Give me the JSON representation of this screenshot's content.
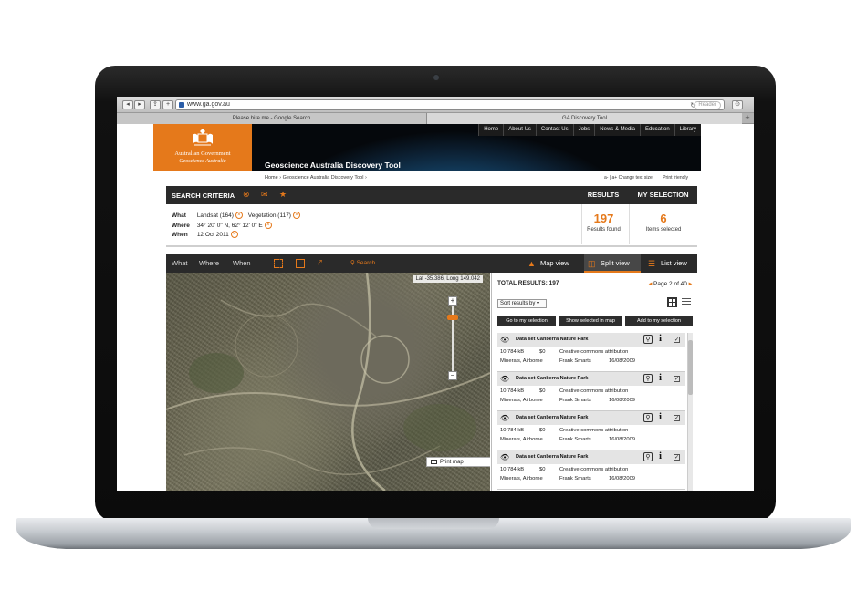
{
  "browser": {
    "url": "www.ga.gov.au",
    "reader_label": "Reader",
    "tabs": [
      "Please hire me - Google Search",
      "GA Discovery Tool"
    ]
  },
  "site": {
    "logo_line1": "Australian Government",
    "logo_line2": "Geoscience Australia",
    "topnav": [
      "Home",
      "About Us",
      "Contact Us",
      "Jobs",
      "News & Media",
      "Education",
      "Library"
    ],
    "tool_title": "Geoscience Australia Discovery Tool",
    "breadcrumb": [
      "Home",
      "Geoscience Australia Discovery Tool"
    ],
    "text_size_label": "a- | a+ Change text size",
    "print_friendly_label": "Print friendly"
  },
  "criteria": {
    "title": "SEARCH CRITERIA",
    "what_label": "What",
    "what_values": [
      "Landsat (164)",
      "Vegetation (117)"
    ],
    "where_label": "Where",
    "where_value": "34° 20' 0\" N, 62° 12' 0\" E",
    "when_label": "When",
    "when_value": "12 Oct 2011"
  },
  "summary": {
    "results_tab": "RESULTS",
    "selection_tab": "MY SELECTION",
    "results_count": "197",
    "results_label": "Results found",
    "selection_count": "6",
    "selection_label": "Items selected"
  },
  "viewbar": {
    "filters": [
      "What",
      "Where",
      "When"
    ],
    "search_label": "Search",
    "views": [
      "Map view",
      "Split view",
      "List view"
    ],
    "active_view": "Split view"
  },
  "map": {
    "latlong": "Lat -35.386, Long 149.042",
    "print_label": "Print map",
    "zoom_level": 0.15
  },
  "results": {
    "total_label": "TOTAL RESULTS:",
    "total_value": "197",
    "pager": "Page 2 of 40",
    "sort_label": "Sort results by",
    "actions": [
      "Go to my selection",
      "Show selected in map",
      "Add to my selection"
    ],
    "items": [
      {
        "title": "Data set Canberra Nature Park",
        "size": "10.784 kB",
        "price": "$0",
        "license": "Creative commons attribution",
        "category": "Minerals, Airborne",
        "author": "Frank Smarts",
        "date": "16/08/2009"
      },
      {
        "title": "Data set Canberra Nature Park",
        "size": "10.784 kB",
        "price": "$0",
        "license": "Creative commons attribution",
        "category": "Minerals, Airborne",
        "author": "Frank Smarts",
        "date": "16/08/2009"
      },
      {
        "title": "Data set Canberra Nature Park",
        "size": "10.784 kB",
        "price": "$0",
        "license": "Creative commons attribution",
        "category": "Minerals, Airborne",
        "author": "Frank Smarts",
        "date": "16/08/2009"
      },
      {
        "title": "Data set Canberra Nature Park",
        "size": "10.784 kB",
        "price": "$0",
        "license": "Creative commons attribution",
        "category": "Minerals, Airborne",
        "author": "Frank Smarts",
        "date": "16/08/2009"
      }
    ]
  },
  "colors": {
    "accent": "#e5791b",
    "bar_dark": "#2a2a2a"
  }
}
